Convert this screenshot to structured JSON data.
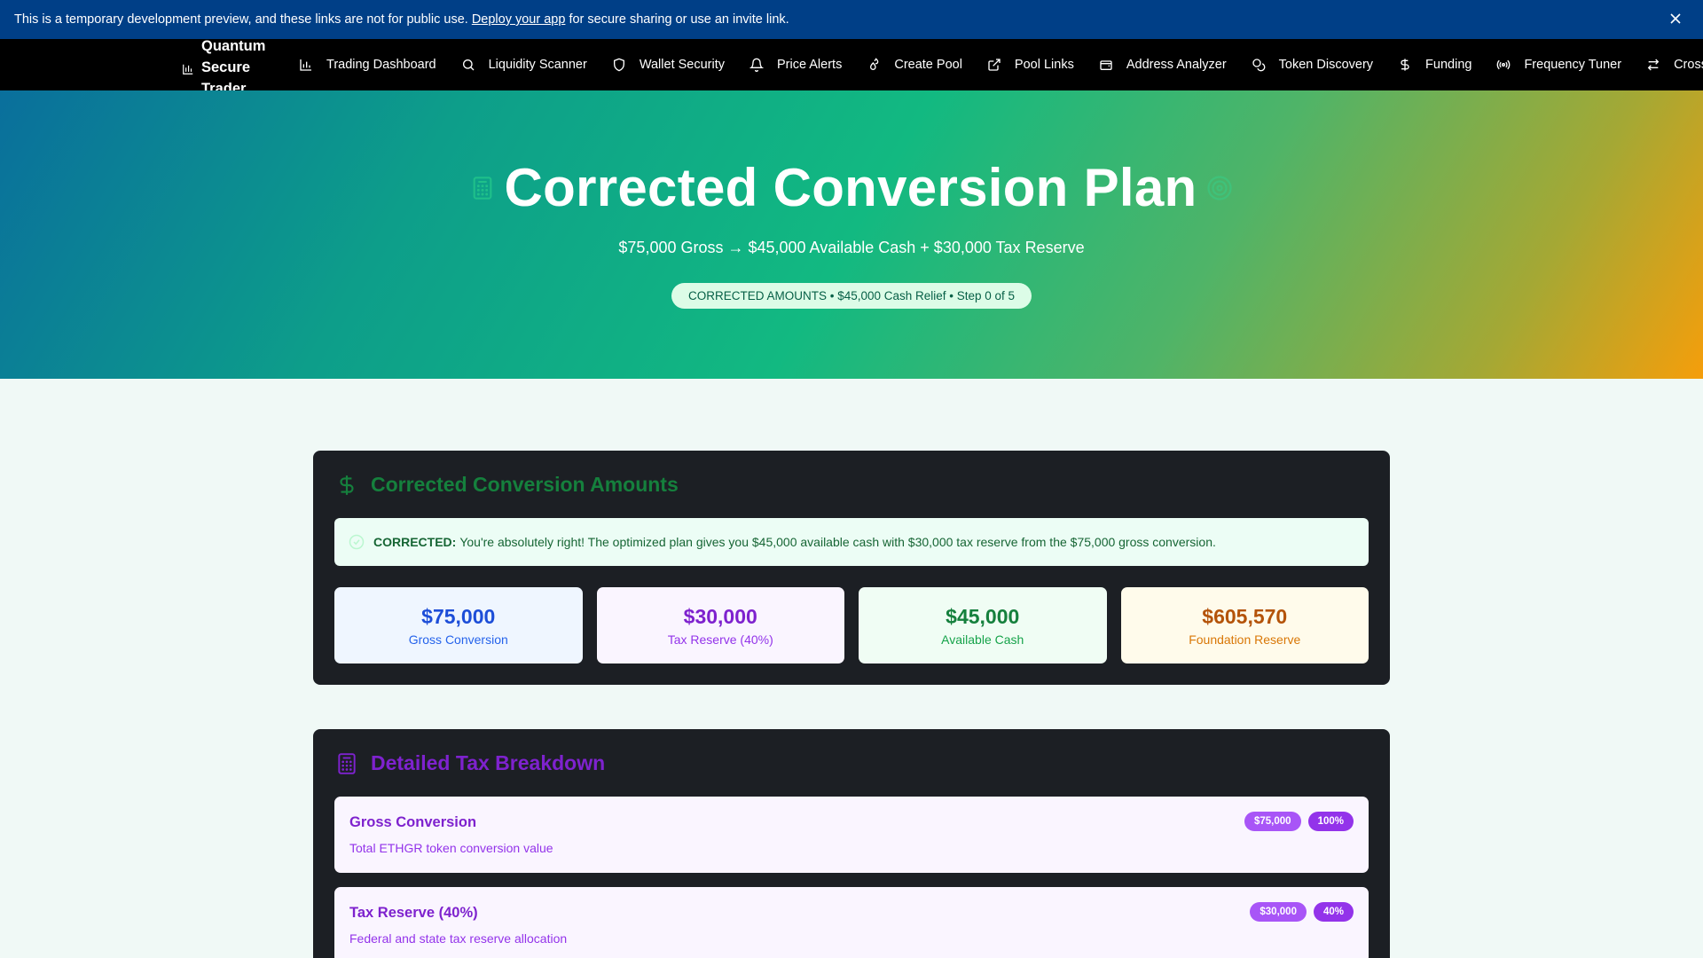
{
  "banner": {
    "text_before": "This is a temporary development preview, and these links are not for public use.",
    "link": "Deploy your app",
    "text_after": "for secure sharing or use an invite link."
  },
  "nav": {
    "brand": "Quantum Secure Trader",
    "items": [
      {
        "label": "Trading Dashboard",
        "icon": "bar-chart-icon"
      },
      {
        "label": "Liquidity Scanner",
        "icon": "search-icon"
      },
      {
        "label": "Wallet Security",
        "icon": "shield-icon"
      },
      {
        "label": "Price Alerts",
        "icon": "bell-icon"
      },
      {
        "label": "Create Pool",
        "icon": "droplets-icon"
      },
      {
        "label": "Pool Links",
        "icon": "external-link-icon"
      },
      {
        "label": "Address Analyzer",
        "icon": "wallet-icon"
      },
      {
        "label": "Token Discovery",
        "icon": "coins-icon"
      },
      {
        "label": "Funding",
        "icon": "dollar-icon"
      },
      {
        "label": "Frequency Tuner",
        "icon": "radio-icon"
      },
      {
        "label": "Cross-Ch",
        "icon": "arrows-icon"
      }
    ]
  },
  "hero": {
    "title": "Corrected Conversion Plan",
    "subtitle": "$75,000 Gross → $45,000 Available Cash + $30,000 Tax Reserve",
    "pill": "CORRECTED AMOUNTS • $45,000 Cash Relief • Step 0 of 5"
  },
  "amounts": {
    "heading": "Corrected Conversion Amounts",
    "alert_label": "CORRECTED:",
    "alert_text": "You're absolutely right! The optimized plan gives you $45,000 available cash with $30,000 tax reserve from the $75,000 gross conversion.",
    "stats": [
      {
        "value": "$75,000",
        "label": "Gross Conversion"
      },
      {
        "value": "$30,000",
        "label": "Tax Reserve (40%)"
      },
      {
        "value": "$45,000",
        "label": "Available Cash"
      },
      {
        "value": "$605,570",
        "label": "Foundation Reserve"
      }
    ]
  },
  "tax": {
    "heading": "Detailed Tax Breakdown",
    "rows": [
      {
        "title": "Gross Conversion",
        "desc": "Total ETHGR token conversion value",
        "amount": "$75,000",
        "pct": "100%"
      },
      {
        "title": "Tax Reserve (40%)",
        "desc": "Federal and state tax reserve allocation",
        "amount": "$30,000",
        "pct": "40%"
      }
    ]
  },
  "colors": {
    "banner": "#003f87",
    "nav": "#000000",
    "card": "#1c1f24",
    "green_accent": "#15803d",
    "purple_accent": "#7e22ce"
  }
}
